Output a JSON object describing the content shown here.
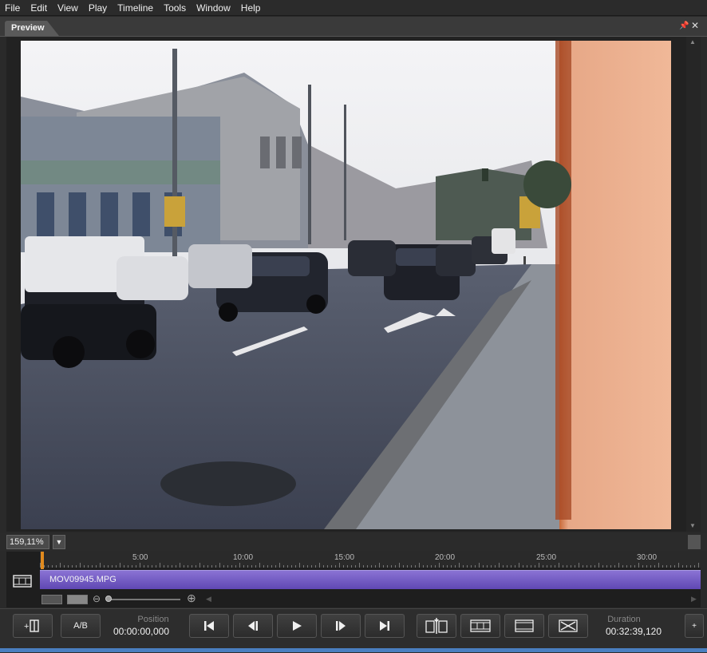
{
  "menu": [
    "File",
    "Edit",
    "View",
    "Play",
    "Timeline",
    "Tools",
    "Window",
    "Help"
  ],
  "panel": {
    "tab_label": "Preview",
    "pin_icon": "pin-icon",
    "close_icon": "close-icon"
  },
  "zoom": {
    "value": "159,11%"
  },
  "timeline": {
    "ticks": [
      "5:00",
      "10:00",
      "15:00",
      "20:00",
      "25:00",
      "30:00"
    ],
    "clip_name": "MOV09945.MPG"
  },
  "transport": {
    "ab_label": "A/B",
    "position_label": "Position",
    "position_value": "00:00:00,000",
    "duration_label": "Duration",
    "duration_value": "00:32:39,120"
  },
  "colors": {
    "accent_playhead": "#e08a1e",
    "clip_color": "#6b54c2",
    "background": "#2a2a2a"
  }
}
